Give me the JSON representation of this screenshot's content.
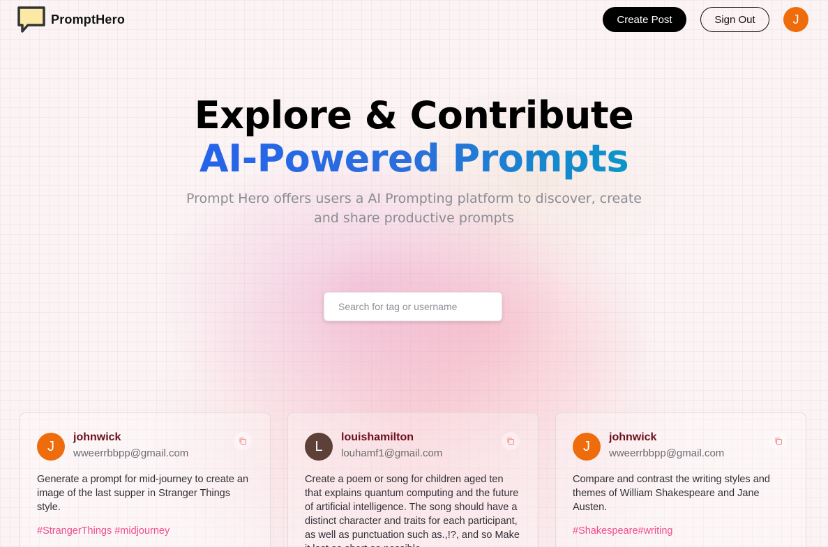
{
  "brand": {
    "name": "PromptHero"
  },
  "nav": {
    "create_label": "Create Post",
    "signout_label": "Sign Out",
    "avatar_initial": "J"
  },
  "hero": {
    "title_line1": "Explore & Contribute",
    "title_line2": "AI-Powered Prompts",
    "description": "Prompt Hero offers users a AI Prompting platform to discover, create and share productive prompts"
  },
  "search": {
    "placeholder": "Search for tag or username",
    "value": ""
  },
  "posts": [
    {
      "initial": "J",
      "avatar_color": "#ef6c0c",
      "username": "johnwick",
      "email": "wweerrbbpp@gmail.com",
      "prompt": "Generate a prompt for mid-journey to create an image of the last supper in Stranger Things style.",
      "tags": "#StrangerThings #midjourney"
    },
    {
      "initial": "L",
      "avatar_color": "#5d4037",
      "username": "louishamilton",
      "email": "louhamf1@gmail.com",
      "prompt": "Create a poem or song for children aged ten that explains quantum computing and the future of artificial intelligence. The song should have a distinct character and traits for each participant, as well as punctuation such as.,!?, and so Make it last as short as possible.",
      "tags": ""
    },
    {
      "initial": "J",
      "avatar_color": "#ef6c0c",
      "username": "johnwick",
      "email": "wweerrbbpp@gmail.com",
      "prompt": "Compare and contrast the writing styles and themes of William Shakespeare and Jane Austen.",
      "tags": "#Shakespeare#writing"
    }
  ]
}
